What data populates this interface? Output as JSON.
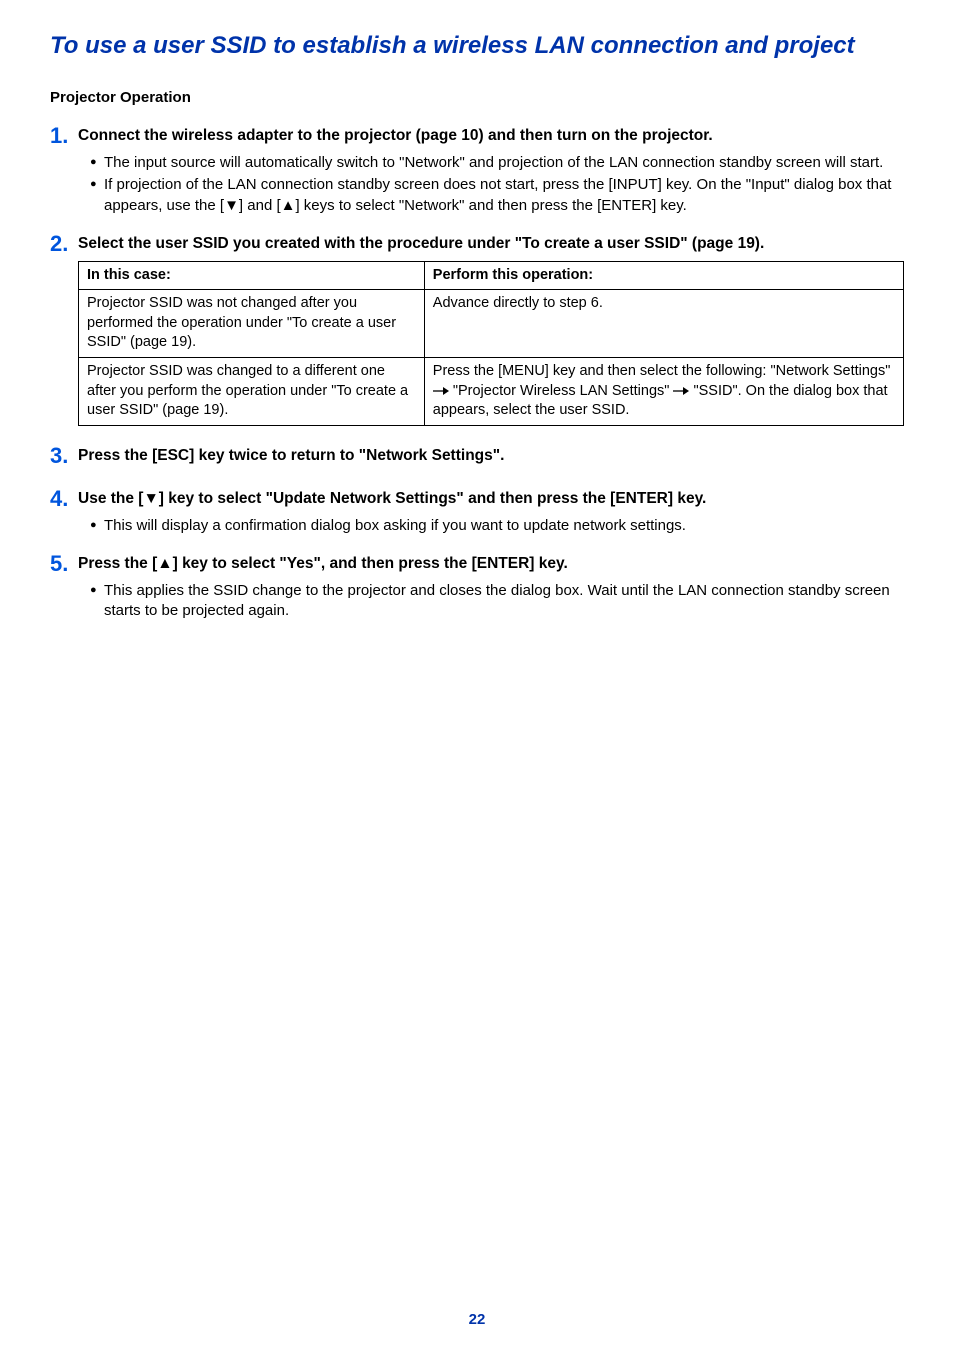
{
  "title": "To use a user SSID to establish a wireless LAN connection and project",
  "subheading": "Projector Operation",
  "steps": [
    {
      "num": "1.",
      "title": "Connect the wireless adapter to the projector (page 10) and then turn on the projector.",
      "bullets": [
        "The input source will automatically switch to \"Network\" and projection of the LAN connection standby screen will start.",
        "If projection of the LAN connection standby screen does not start, press the [INPUT] key. On the \"Input\" dialog box that appears, use the [▼] and [▲] keys to select \"Network\" and then press the [ENTER] key."
      ]
    },
    {
      "num": "2.",
      "title": "Select the user SSID you created with the procedure under \"To create a user SSID\" (page 19).",
      "table": {
        "headers": [
          "In this case:",
          "Perform this operation:"
        ],
        "rows": [
          {
            "case": "Projector SSID was not changed after you performed the operation under \"To create a user SSID\" (page 19).",
            "op": "Advance directly to step 6."
          },
          {
            "case": "Projector SSID was changed to a different one after you perform the operation under \"To create a user SSID\" (page 19).",
            "op_parts": [
              "Press the [MENU] key and then select the following: \"Network Settings\" ",
              " \"Projector Wireless LAN Settings\" ",
              " \"SSID\". On the dialog box that appears, select the user SSID."
            ]
          }
        ]
      }
    },
    {
      "num": "3.",
      "title": "Press the [ESC] key twice to return to \"Network Settings\"."
    },
    {
      "num": "4.",
      "title": "Use the [▼] key to select \"Update Network Settings\" and then press the [ENTER] key.",
      "bullets": [
        "This will display a confirmation dialog box asking if you want to update network settings."
      ]
    },
    {
      "num": "5.",
      "title": "Press the [▲] key to select \"Yes\", and then press the [ENTER] key.",
      "bullets": [
        "This applies the SSID change to the projector and closes the dialog box. Wait until the LAN connection standby screen starts to be projected again."
      ]
    }
  ],
  "page_number": "22"
}
